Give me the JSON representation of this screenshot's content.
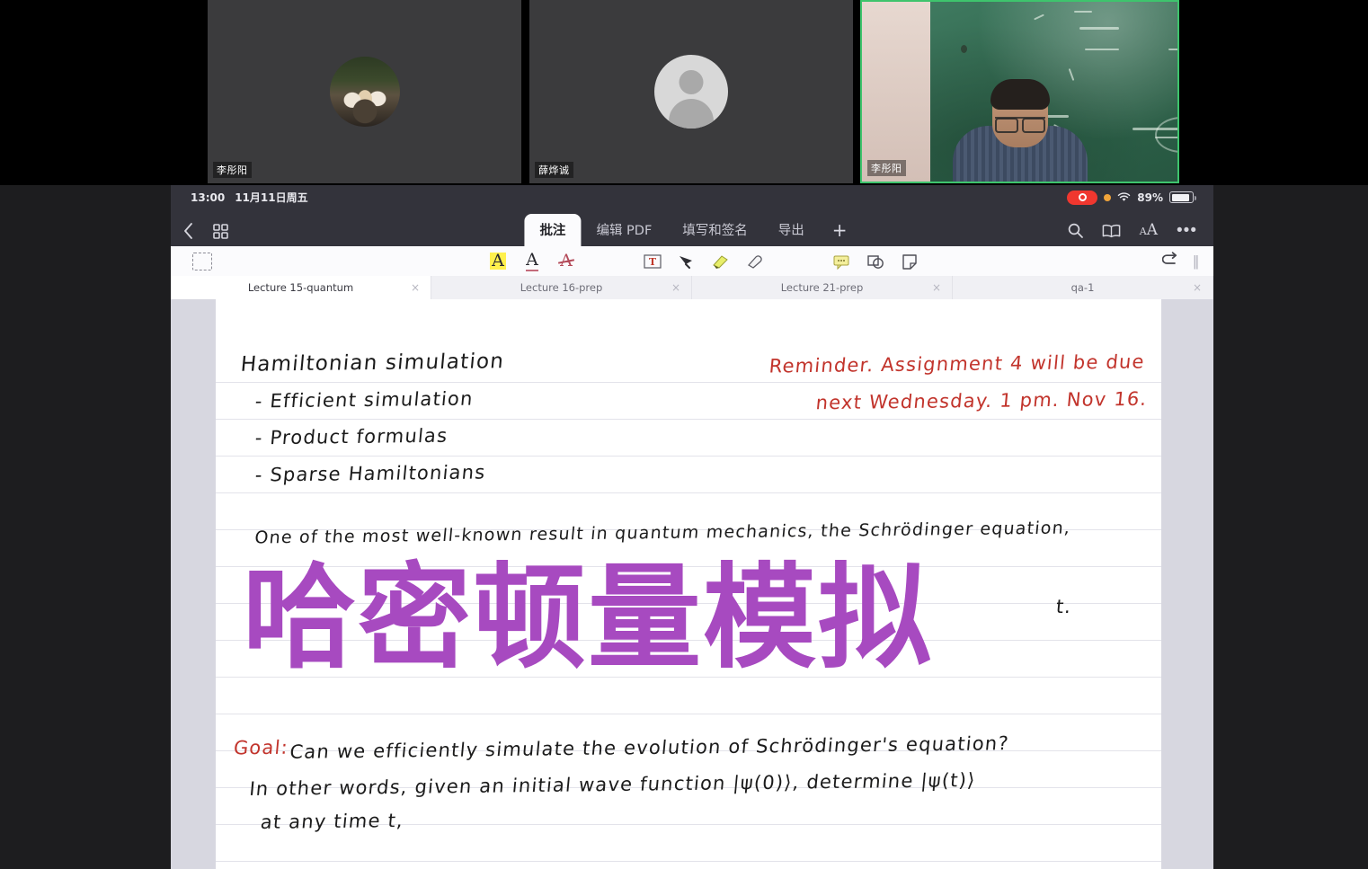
{
  "video_conference": {
    "tiles": [
      {
        "name": "李彤阳",
        "avatar": "cats-photo-avatar",
        "active_speaker": false
      },
      {
        "name": "薛烨诚",
        "avatar": "default-person-avatar",
        "active_speaker": false
      },
      {
        "name": "李彤阳",
        "avatar": "live-video-chalkboard",
        "active_speaker": true
      }
    ]
  },
  "status_bar": {
    "time": "13:00",
    "date": "11月11日周五",
    "recording_icon": "record-indicator",
    "privacy_dot": "orange-privacy-dot",
    "wifi_icon": "wifi-icon",
    "battery_percent": "89%",
    "battery_icon": "battery-icon"
  },
  "app_toolbar": {
    "back_icon": "chevron-left-icon",
    "grid_icon": "grid-view-icon",
    "tabs": [
      {
        "label": "批注",
        "active": true
      },
      {
        "label": "编辑 PDF",
        "active": false
      },
      {
        "label": "填写和签名",
        "active": false
      },
      {
        "label": "导出",
        "active": false
      }
    ],
    "add_tab_label": "+",
    "search_icon": "search-icon",
    "reader_icon": "book-reader-icon",
    "text_size_icon": "text-size-icon",
    "more_icon": "more-horizontal-icon"
  },
  "annotation_bar": {
    "select_icon": "selection-rectangle-icon",
    "tools": [
      {
        "icon": "highlight-text-icon",
        "label": "A",
        "state": "highlight"
      },
      {
        "icon": "underline-text-icon",
        "label": "A",
        "state": "underline"
      },
      {
        "icon": "strikethrough-text-icon",
        "label": "A",
        "state": "strikethrough"
      },
      {
        "icon": "text-box-icon",
        "label": "T"
      },
      {
        "icon": "pen-icon"
      },
      {
        "icon": "highlighter-marker-icon"
      },
      {
        "icon": "eraser-icon"
      },
      {
        "icon": "comment-bubble-icon"
      },
      {
        "icon": "shapes-icon"
      },
      {
        "icon": "sticky-note-icon"
      }
    ],
    "undo_icon": "undo-icon",
    "grip_icon": "drag-grip-icon"
  },
  "document_tabs": [
    {
      "label": "Lecture 15-quantum",
      "active": true,
      "close_icon": "close-icon"
    },
    {
      "label": "Lecture 16-prep",
      "active": false,
      "close_icon": "close-icon"
    },
    {
      "label": "Lecture 21-prep",
      "active": false,
      "close_icon": "close-icon"
    },
    {
      "label": "qa-1",
      "active": false,
      "close_icon": "close-icon"
    }
  ],
  "notes": {
    "heading": "Hamiltonian  simulation",
    "bullets": [
      "- Efficient  simulation",
      "- Product  formulas",
      "- Sparse  Hamiltonians"
    ],
    "reminder_line_1": "Reminder.  Assignment  4  will  be  due",
    "reminder_line_2": "next Wednesday.  1 pm.  Nov 16.",
    "body_line": "One of the most well-known result in quantum mechanics, the Schrödinger equation,",
    "goal_label": "Goal:",
    "goal_text": "Can we efficiently simulate the evolution of Schrödinger's equation?",
    "detail_line_1": "In other words, given an initial wave function |ψ(0)⟩, determine |ψ(t)⟩",
    "detail_line_2": "at any time t,",
    "clipped_right": "t."
  },
  "overlay": {
    "title": "哈密顿量模拟",
    "color": "#a74ac0"
  }
}
